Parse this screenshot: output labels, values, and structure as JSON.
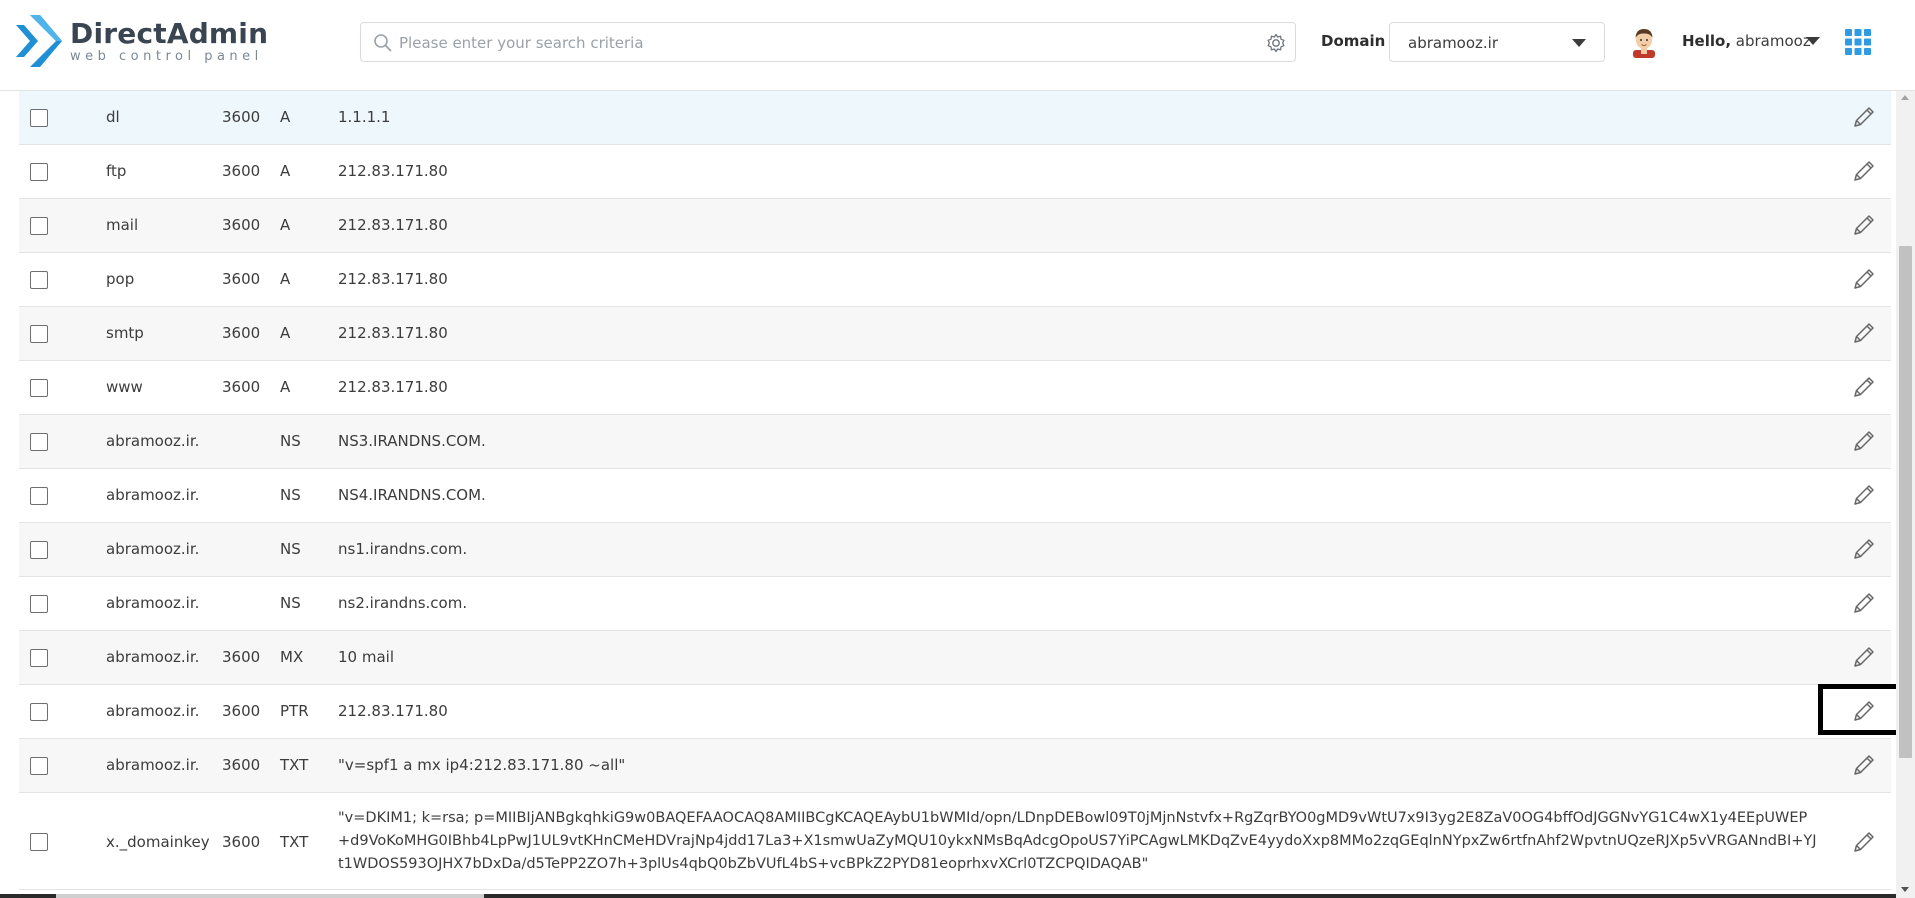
{
  "header": {
    "logo_title": "DirectAdmin",
    "logo_subtitle": "web control panel",
    "search_placeholder": "Please enter your search criteria",
    "domain_label": "Domain",
    "domain_value": "abramooz.ir",
    "greeting": "Hello,",
    "username": "abramooz"
  },
  "colors": {
    "brand_blue": "#1f8fd6",
    "highlight_row": "#eef7fc"
  },
  "records": [
    {
      "name": "dl",
      "ttl": "3600",
      "type": "A",
      "value": "1.1.1.1"
    },
    {
      "name": "ftp",
      "ttl": "3600",
      "type": "A",
      "value": "212.83.171.80"
    },
    {
      "name": "mail",
      "ttl": "3600",
      "type": "A",
      "value": "212.83.171.80"
    },
    {
      "name": "pop",
      "ttl": "3600",
      "type": "A",
      "value": "212.83.171.80"
    },
    {
      "name": "smtp",
      "ttl": "3600",
      "type": "A",
      "value": "212.83.171.80"
    },
    {
      "name": "www",
      "ttl": "3600",
      "type": "A",
      "value": "212.83.171.80"
    },
    {
      "name": "abramooz.ir.",
      "ttl": "",
      "type": "NS",
      "value": "NS3.IRANDNS.COM."
    },
    {
      "name": "abramooz.ir.",
      "ttl": "",
      "type": "NS",
      "value": "NS4.IRANDNS.COM."
    },
    {
      "name": "abramooz.ir.",
      "ttl": "",
      "type": "NS",
      "value": "ns1.irandns.com."
    },
    {
      "name": "abramooz.ir.",
      "ttl": "",
      "type": "NS",
      "value": "ns2.irandns.com."
    },
    {
      "name": "abramooz.ir.",
      "ttl": "3600",
      "type": "MX",
      "value": "10 mail"
    },
    {
      "name": "abramooz.ir.",
      "ttl": "3600",
      "type": "PTR",
      "value": "212.83.171.80"
    },
    {
      "name": "abramooz.ir.",
      "ttl": "3600",
      "type": "TXT",
      "value": "\"v=spf1 a mx ip4:212.83.171.80 ~all\""
    },
    {
      "name": "x._domainkey",
      "ttl": "3600",
      "type": "TXT",
      "value": "\"v=DKIM1; k=rsa; p=MIIBIjANBgkqhkiG9w0BAQEFAAOCAQ8AMIIBCgKCAQEAybU1bWMId/opn/LDnpDEBowl09T0jMjnNstvfx+RgZqrBYO0gMD9vWtU7x9I3yg2E8ZaV0OG4bffOdJGGNvYG1C4wX1y4EEpUWEP+d9VoKoMHG0IBhb4LpPwJ1UL9vtKHnCMeHDVrajNp4jdd17La3+X1smwUaZyMQU10ykxNMsBqAdcgOpoUS7YiPCAgwLMKDqZvE4yydoXxp8MMo2zqGEqlnNYpxZw6rtfnAhf2WpvtnUQzeRJXp5vVRGANndBI+YJt1WDOS593OJHX7bDxDa/d5TePP2ZO7h+3plUs4qbQ0bZbVUfL4bS+vcBPkZ2PYD81eoprhxvXCrl0TZCPQIDAQAB\""
    }
  ]
}
